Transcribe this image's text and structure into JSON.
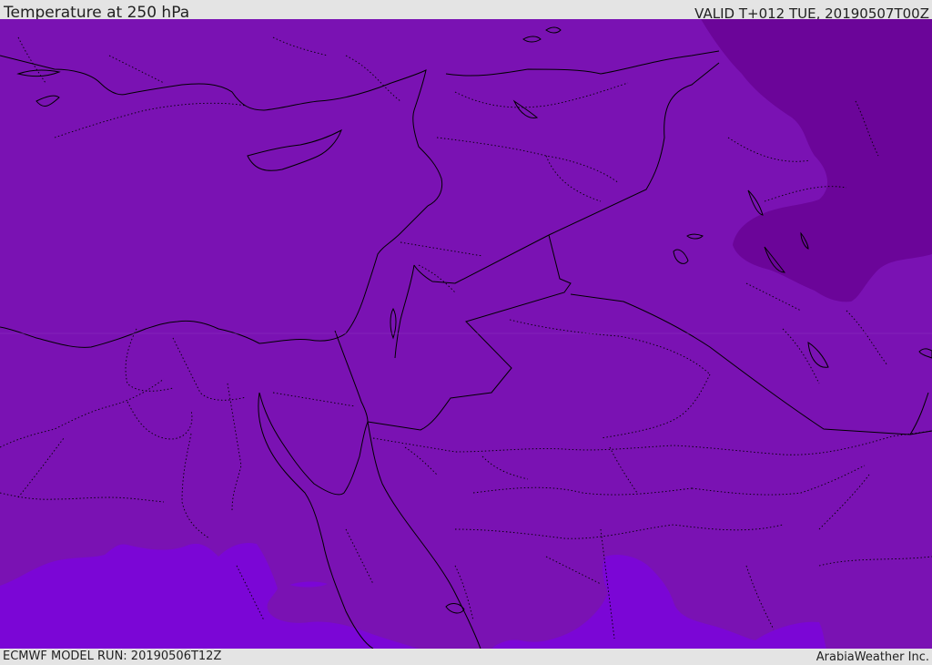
{
  "header": {
    "title": "Temperature at 250 hPa",
    "valid_time": "VALID T+012 TUE, 20190507T00Z"
  },
  "footer": {
    "model_run": "ECMWF MODEL RUN: 20190506T12Z",
    "credit": "ArabiaWeather Inc."
  },
  "map": {
    "variable": "Temperature",
    "level": "250 hPa",
    "colors": {
      "base": "#7a12b3",
      "cold": "#6b0599",
      "warm": "#7b06d6",
      "coastline": "#000000",
      "border": "#000000"
    }
  }
}
